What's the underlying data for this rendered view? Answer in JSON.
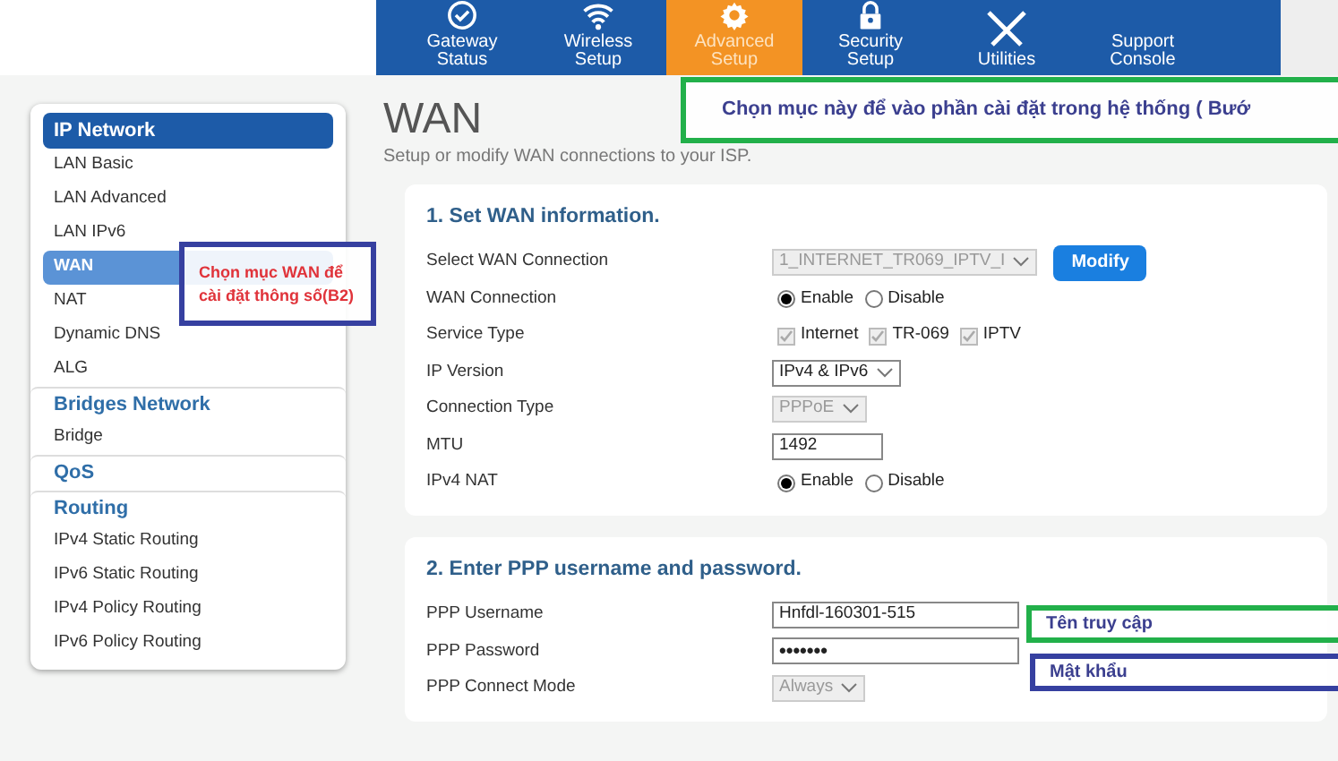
{
  "nav": [
    {
      "label": "Gateway Status",
      "selected": false
    },
    {
      "label": "Wireless Setup",
      "selected": false
    },
    {
      "label": "Advanced Setup",
      "selected": true
    },
    {
      "label": "Security Setup",
      "selected": false
    },
    {
      "label": "Utilities",
      "selected": false
    },
    {
      "label": "Support Console",
      "selected": false
    }
  ],
  "sidebar": {
    "items": [
      {
        "kind": "group",
        "label": "IP Network",
        "selected": true
      },
      {
        "kind": "item",
        "label": "LAN Basic",
        "selected": false
      },
      {
        "kind": "item",
        "label": "LAN Advanced",
        "selected": false
      },
      {
        "kind": "item",
        "label": "LAN IPv6",
        "selected": false
      },
      {
        "kind": "item",
        "label": "WAN",
        "selected": true
      },
      {
        "kind": "item",
        "label": "NAT",
        "selected": false
      },
      {
        "kind": "item",
        "label": "Dynamic DNS",
        "selected": false
      },
      {
        "kind": "item",
        "label": "ALG",
        "selected": false
      },
      {
        "kind": "group",
        "label": "Bridges Network",
        "selected": false
      },
      {
        "kind": "item",
        "label": "Bridge",
        "selected": false
      },
      {
        "kind": "group",
        "label": "QoS",
        "selected": false
      },
      {
        "kind": "group",
        "label": "Routing",
        "selected": false
      },
      {
        "kind": "item",
        "label": "IPv4 Static Routing",
        "selected": false
      },
      {
        "kind": "item",
        "label": "IPv6 Static Routing",
        "selected": false
      },
      {
        "kind": "item",
        "label": "IPv4 Policy Routing",
        "selected": false
      },
      {
        "kind": "item",
        "label": "IPv6 Policy Routing",
        "selected": false
      }
    ]
  },
  "page": {
    "title": "WAN",
    "subtitle": "Setup or modify WAN connections to your ISP."
  },
  "sections": [
    {
      "title": "1. Set WAN information.",
      "rows": [
        {
          "kind": "select",
          "label": "Select WAN Connection",
          "value": "1_INTERNET_TR069_IPTV_I",
          "disabled": true,
          "button": "Modify"
        },
        {
          "kind": "radio",
          "label": "WAN Connection",
          "options": [
            {
              "label": "Enable",
              "selected": true
            },
            {
              "label": "Disable",
              "selected": false
            }
          ]
        },
        {
          "kind": "checks",
          "label": "Service Type",
          "options": [
            {
              "label": "Internet",
              "checked": true
            },
            {
              "label": "TR-069",
              "checked": true
            },
            {
              "label": "IPTV",
              "checked": true
            }
          ]
        },
        {
          "kind": "select",
          "label": "IP Version",
          "value": "IPv4 & IPv6",
          "disabled": false
        },
        {
          "kind": "select",
          "label": "Connection Type",
          "value": "PPPoE",
          "disabled": true
        },
        {
          "kind": "input",
          "label": "MTU",
          "value": "1492"
        },
        {
          "kind": "radio",
          "label": "IPv4 NAT",
          "options": [
            {
              "label": "Enable",
              "selected": true
            },
            {
              "label": "Disable",
              "selected": false
            }
          ]
        }
      ]
    },
    {
      "title": "2. Enter PPP username and password.",
      "rows": [
        {
          "kind": "input",
          "label": "PPP Username",
          "value": "Hnfdl-160301-515"
        },
        {
          "kind": "password",
          "label": "PPP Password",
          "value": "•••••••"
        },
        {
          "kind": "select",
          "label": "PPP Connect Mode",
          "value": "Always",
          "disabled": true
        }
      ]
    }
  ],
  "annotations": [
    {
      "kind": "note",
      "text": "Chọn mục này để vào phần cài đặt trong hệ thống ( Bướ",
      "color": "#22b04a"
    },
    {
      "kind": "warning",
      "text": "Chọn mục WAN để cài đặt thông số(B2)",
      "color": "#3640a0"
    },
    {
      "kind": "note",
      "text": "Tên truy cập",
      "color": "#22b04a"
    },
    {
      "kind": "note",
      "text": "Mật khẩu",
      "color": "#3640a0"
    }
  ]
}
